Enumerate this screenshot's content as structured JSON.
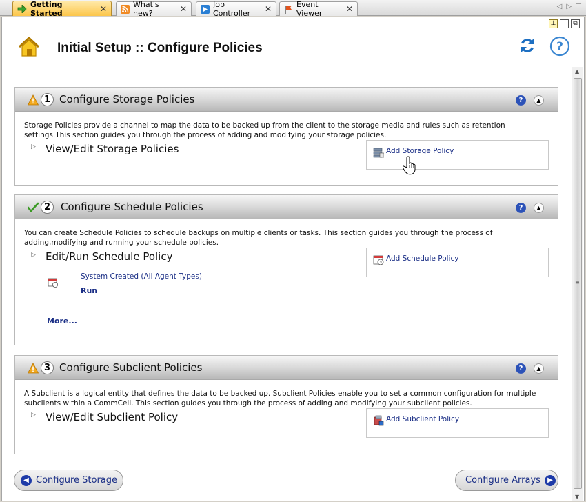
{
  "tabs": [
    {
      "label": "Getting Started",
      "icon": "arrow-right-icon",
      "active": true
    },
    {
      "label": "What's new?",
      "icon": "rss-icon",
      "active": false
    },
    {
      "label": "Job Controller",
      "icon": "play-icon",
      "active": false
    },
    {
      "label": "Event Viewer",
      "icon": "flag-icon",
      "active": false
    }
  ],
  "header": {
    "title": "Initial Setup :: Configure Policies"
  },
  "sections": [
    {
      "number": "1",
      "status": "warning",
      "title": "Configure Storage Policies",
      "description": "Storage Policies provide a channel to map the data to be backed up from the client to the storage media and rules such as retention settings.This section guides you through the process of adding and modifying your storage policies.",
      "row_title": "View/Edit Storage Policies",
      "action": "Add Storage Policy"
    },
    {
      "number": "2",
      "status": "ok",
      "title": "Configure Schedule Policies",
      "description": "You can create Schedule Policies to schedule backups on multiple clients or tasks. This section guides you through the process of adding,modifying and running your schedule policies.",
      "row_title": "Edit/Run Schedule Policy",
      "action": "Add Schedule Policy",
      "policy_item": "System Created (All Agent Types)",
      "run_label": "Run",
      "more_label": "More..."
    },
    {
      "number": "3",
      "status": "warning",
      "title": "Configure Subclient Policies",
      "description": "A Subclient is a logical entity that defines the data to be backed up. Subclient Policies enable you to set a common configuration for multiple subclients within a CommCell. This section guides you through the process of adding and modifying your subclient policies.",
      "row_title": "View/Edit Subclient Policy",
      "action": "Add Subclient Policy"
    }
  ],
  "footer": {
    "back_label": "Configure Storage",
    "next_label": "Configure Arrays"
  },
  "colors": {
    "accent": "#1e3ba8",
    "active_tab": "#fcc64b",
    "link": "#1b2f86"
  }
}
